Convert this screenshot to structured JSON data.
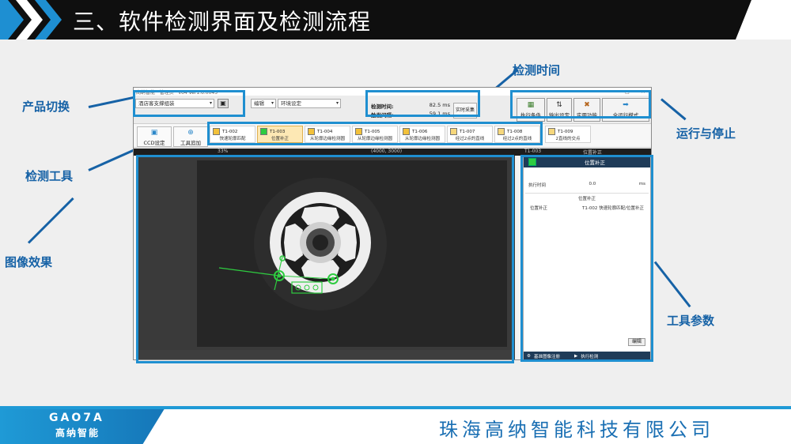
{
  "slide": {
    "title": "三、软件检测界面及检测流程",
    "company": "珠海高纳智能科技有限公司",
    "logo_text": "GAO7A",
    "logo_sub": "高纳智能"
  },
  "labels": {
    "product_switch": "产品切换",
    "detection_tools": "检测工具",
    "image_effect": "图像效果",
    "detection_time": "检测时间",
    "run_stop": "运行与停止",
    "tool_params": "工具参数"
  },
  "app": {
    "title": "高纳智能 · 管理员 · v64 Ver1.6.0045",
    "product_select": "酒店客支撑组装",
    "menu_edit": "编辑",
    "env_setting": "环境设定",
    "time": {
      "detect_label": "检测时间:",
      "detect_value": "82.5 ms",
      "trigger_label": "触发间隔:",
      "trigger_value": "59.1 ms",
      "realtime_button": "实时采集"
    },
    "run_buttons": [
      "执行条件",
      "输出设定",
      "实用功能",
      "全运行模式"
    ],
    "big_tools": [
      "CCD设定",
      "工具追加"
    ],
    "tools": [
      {
        "id": "T1-002",
        "name": "快速轮廓匹配"
      },
      {
        "id": "T1-003",
        "name": "位置补正"
      },
      {
        "id": "T1-004",
        "name": "从轮廓边缘检测圆"
      },
      {
        "id": "T1-005",
        "name": "从轮廓边缘检测圆"
      },
      {
        "id": "T1-006",
        "name": "从轮廓边缘检测圆"
      },
      {
        "id": "T1-007",
        "name": "经过2点的直线"
      },
      {
        "id": "T1-008",
        "name": "经过2点的直线"
      },
      {
        "id": "T1-009",
        "name": "2直线的交点"
      }
    ],
    "view_header": {
      "zoom": "33%",
      "size": "(4000, 3000)",
      "tool_id": "T1-003",
      "tool_name": "位置补正"
    },
    "panel": {
      "title": "位置补正",
      "exec_label": "执行时间",
      "exec_value": "0.0",
      "exec_unit": "ms",
      "section": "位置补正",
      "row_label": "位置补正",
      "row_value": "T1-002 快速轮廓匹配/位置补正",
      "edit_button": "编辑",
      "foot_register": "基准图像注册",
      "foot_run": "执行检测"
    }
  }
}
